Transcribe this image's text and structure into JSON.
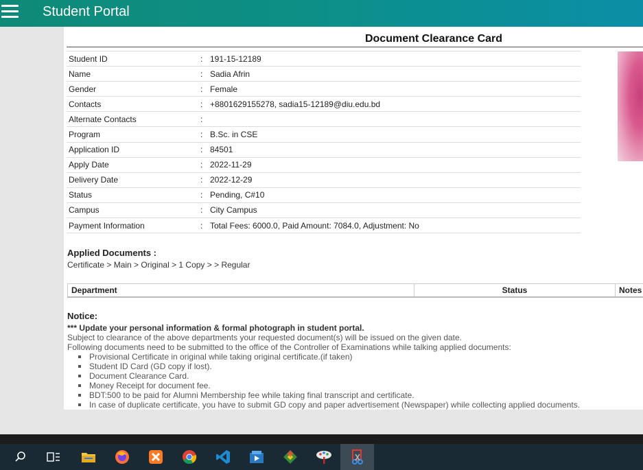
{
  "app": {
    "title": "Student Portal"
  },
  "card": {
    "title": "Document Clearance Card",
    "fields": [
      {
        "label": "Student ID",
        "value": "191-15-12189"
      },
      {
        "label": "Name",
        "value": "Sadia Afrin"
      },
      {
        "label": "Gender",
        "value": "Female"
      },
      {
        "label": "Contacts",
        "value": "+8801629155278, sadia15-12189@diu.edu.bd"
      },
      {
        "label": "Alternate Contacts",
        "value": ""
      },
      {
        "label": "Program",
        "value": "B.Sc. in CSE"
      },
      {
        "label": "Application ID",
        "value": "84501"
      },
      {
        "label": "Apply Date",
        "value": "2022-11-29"
      },
      {
        "label": "Delivery Date",
        "value": "2022-12-29"
      },
      {
        "label": "Status",
        "value": "Pending, C#10"
      },
      {
        "label": "Campus",
        "value": "City Campus"
      },
      {
        "label": "Payment Information",
        "value": "Total Fees: 6000.0, Paid Amount: 7084.0, Adjustment: No"
      }
    ],
    "colon": ":",
    "applied": {
      "heading": "Applied Documents :",
      "value": "Certificate > Main > Original > 1 Copy > > Regular"
    },
    "dept_table": {
      "headers": [
        "Department",
        "Status",
        "Notes"
      ]
    },
    "notice": {
      "heading": "Notice:",
      "line1": "*** Update your personal information & formal photograph in student portal.",
      "line2": "Subject to clearance of the above departments your requested document(s) will be issued on the given date.",
      "line3": "Following documents need to be submitted to the office of the Controller of Examinations while talking applied documents:",
      "items": [
        "Provisional Certificate in original while taking original certificate.(if taken)",
        "Student ID Card (GD copy if lost).",
        "Document Clearance Card.",
        "Money Receipt for document fee.",
        "BDT:500 to be paid for Alumni Membership fee while taking final transcript and certificate.",
        "In case of duplicate certificate, you have to submit GD copy and paper advertisement (Newspaper) while collecting applied documents."
      ]
    }
  },
  "taskbar": {
    "icons": [
      "search-icon",
      "task-view-icon",
      "file-explorer-icon",
      "firefox-icon",
      "xampp-icon",
      "chrome-icon",
      "vscode-icon",
      "app-icon",
      "git-icon",
      "paint-icon",
      "snipping-tool-icon"
    ],
    "active": "snipping-tool-icon"
  },
  "colors": {
    "topbar": "#0f8a77",
    "taskbar": "#1a2a34"
  }
}
